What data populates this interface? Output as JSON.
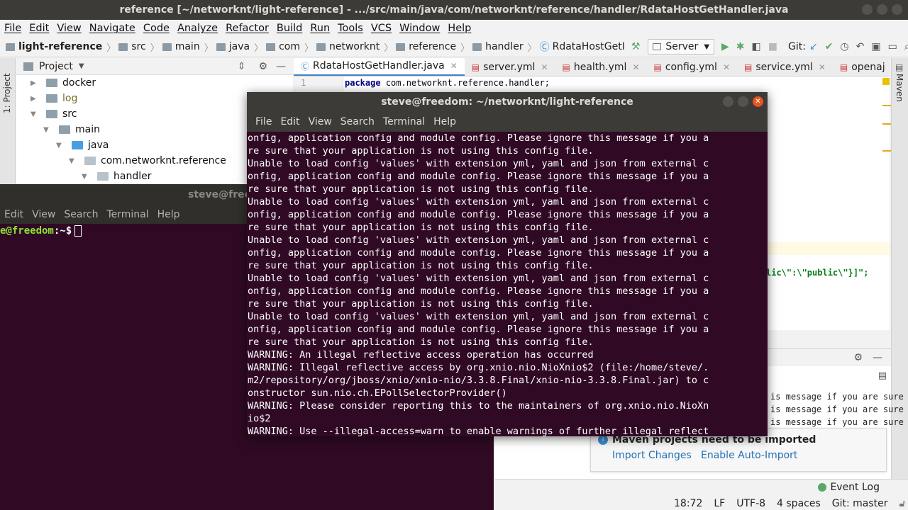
{
  "ide": {
    "title": "reference [~/networknt/light-reference] - .../src/main/java/com/networknt/reference/handler/RdataHostGetHandler.java",
    "menu": [
      "File",
      "Edit",
      "View",
      "Navigate",
      "Code",
      "Analyze",
      "Refactor",
      "Build",
      "Run",
      "Tools",
      "VCS",
      "Window",
      "Help"
    ],
    "breadcrumbs": [
      "light-reference",
      "src",
      "main",
      "java",
      "com",
      "networknt",
      "reference",
      "handler",
      "RdataHostGetI"
    ],
    "run_config": "Server",
    "git_label": "Git:",
    "project_panel": {
      "side_label": "1: Project",
      "title": "Project",
      "tree": [
        {
          "label": "docker",
          "depth": 1,
          "expanded": false
        },
        {
          "label": "log",
          "depth": 1,
          "expanded": false
        },
        {
          "label": "src",
          "depth": 1,
          "expanded": true
        },
        {
          "label": "main",
          "depth": 2,
          "expanded": true
        },
        {
          "label": "java",
          "depth": 3,
          "expanded": true
        },
        {
          "label": "com.networknt.reference",
          "depth": 4,
          "expanded": true
        },
        {
          "label": "handler",
          "depth": 5,
          "expanded": true
        }
      ]
    },
    "tabs": [
      "RdataHostGetHandler.java",
      "server.yml",
      "health.yml",
      "config.yml",
      "service.yml",
      "openaj"
    ],
    "editor": {
      "line_number": "1",
      "keyword": "package",
      "package_name": "com.networknt.reference.handler;",
      "code_fragment": "lic\\\":\\\"public\\\"}]\";"
    },
    "right_label": "Maven",
    "run_output": [
      "is message if you are sure",
      "is message if you are sure",
      "is message if you are sure"
    ],
    "maven_popup": {
      "title": "Maven projects need to be imported",
      "import_changes": "Import Changes",
      "enable_auto_import": "Enable Auto-Import"
    },
    "status": {
      "event_log": "Event Log",
      "position": "18:72",
      "line_sep": "LF",
      "encoding": "UTF-8",
      "indent": "4 spaces",
      "git_branch": "Git: master"
    }
  },
  "terminal_back": {
    "title": "steve@free",
    "menu": [
      "Edit",
      "View",
      "Search",
      "Terminal",
      "Help"
    ],
    "prompt_user": "e@freedom",
    "prompt_rest": ":~$"
  },
  "terminal_front": {
    "title": "steve@freedom: ~/networknt/light-reference",
    "menu": [
      "File",
      "Edit",
      "View",
      "Search",
      "Terminal",
      "Help"
    ],
    "lines": [
      "onfig, application config and module config. Please ignore this message if you a",
      "re sure that your application is not using this config file.",
      "Unable to load config 'values' with extension yml, yaml and json from external c",
      "onfig, application config and module config. Please ignore this message if you a",
      "re sure that your application is not using this config file.",
      "Unable to load config 'values' with extension yml, yaml and json from external c",
      "onfig, application config and module config. Please ignore this message if you a",
      "re sure that your application is not using this config file.",
      "Unable to load config 'values' with extension yml, yaml and json from external c",
      "onfig, application config and module config. Please ignore this message if you a",
      "re sure that your application is not using this config file.",
      "Unable to load config 'values' with extension yml, yaml and json from external c",
      "onfig, application config and module config. Please ignore this message if you a",
      "re sure that your application is not using this config file.",
      "Unable to load config 'values' with extension yml, yaml and json from external c",
      "onfig, application config and module config. Please ignore this message if you a",
      "re sure that your application is not using this config file.",
      "WARNING: An illegal reflective access operation has occurred",
      "WARNING: Illegal reflective access by org.xnio.nio.NioXnio$2 (file:/home/steve/.",
      "m2/repository/org/jboss/xnio/xnio-nio/3.3.8.Final/xnio-nio-3.3.8.Final.jar) to c",
      "onstructor sun.nio.ch.EPollSelectorProvider()",
      "WARNING: Please consider reporting this to the maintainers of org.xnio.nio.NioXn",
      "io$2",
      "WARNING: Use --illegal-access=warn to enable warnings of further illegal reflect"
    ]
  }
}
